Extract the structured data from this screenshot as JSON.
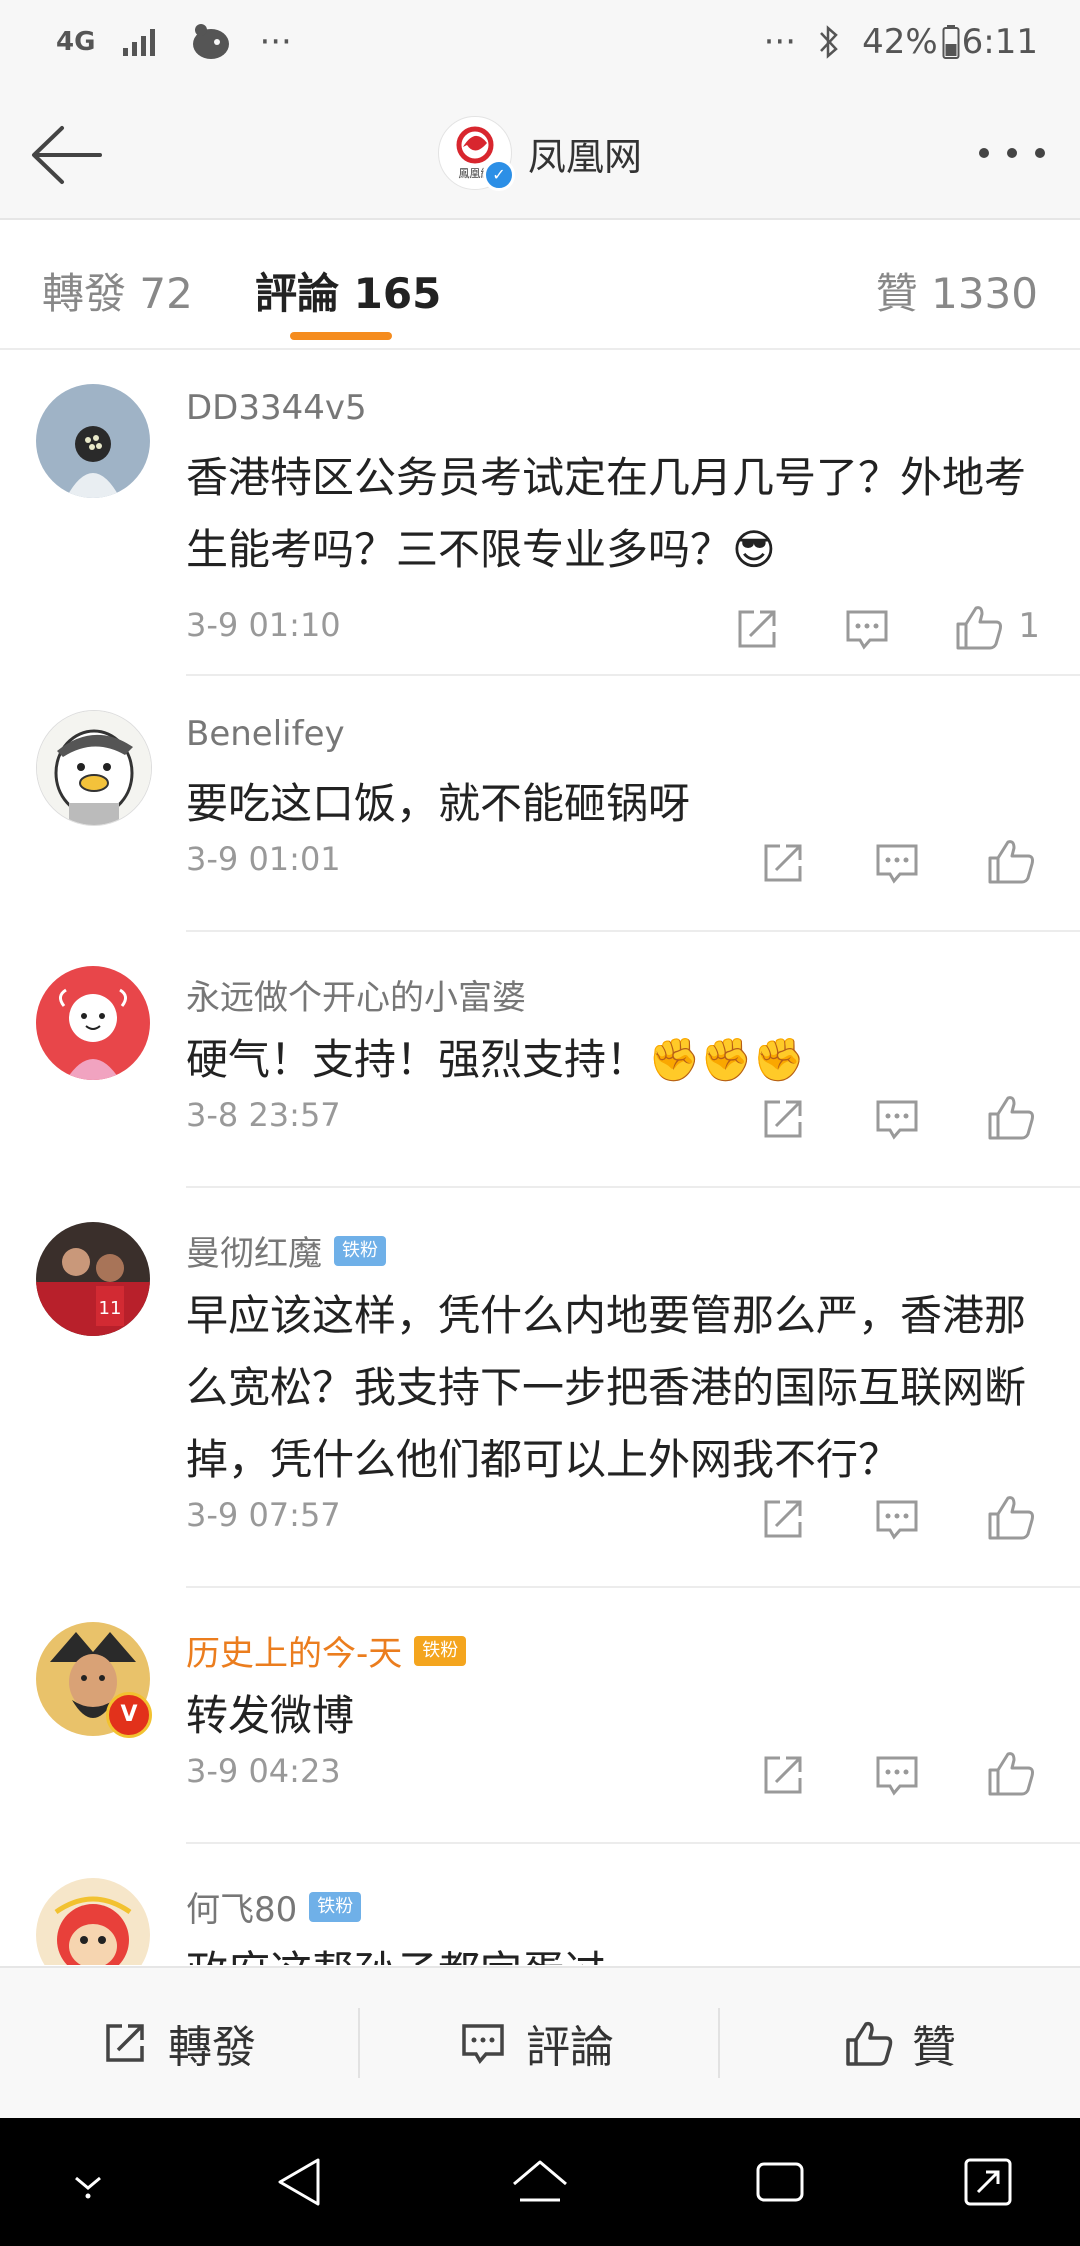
{
  "status_bar": {
    "network": "4G",
    "left_more": "···",
    "right_more": "···",
    "battery": "42%",
    "time": "6:11"
  },
  "header": {
    "account_name": "凤凰网",
    "logo_text": "鳳凰網",
    "back_icon": "arrow-left-icon",
    "more_icon": "more-horizontal-icon"
  },
  "tabs": {
    "reposts": "轉發 72",
    "comments": "評論 165",
    "likes": "贊 1330",
    "active_color": "#f58c1e"
  },
  "comments": [
    {
      "user": "DD3344v5",
      "badge": "",
      "text": "香港特区公务员考试定在几月几号了？外地考生能考吗？三不限专业多吗？😎",
      "time": "3-9 01:10",
      "likes": "1"
    },
    {
      "user": "Benelifey",
      "badge": "",
      "text": "要吃这口饭，就不能砸锅呀",
      "time": "3-9 01:01",
      "likes": ""
    },
    {
      "user": "永远做个开心的小富婆",
      "badge": "",
      "text": "硬气！支持！强烈支持！✊✊✊",
      "time": "3-8 23:57",
      "likes": ""
    },
    {
      "user": "曼彻红魔",
      "badge": "铁粉",
      "text": "早应该这样，凭什么内地要管那么严，香港那么宽松？我支持下一步把香港的国际互联网断掉，凭什么他们都可以上外网我不行？",
      "time": "3-9 07:57",
      "likes": ""
    },
    {
      "user": "历史上的今-天",
      "badge": "铁粉",
      "text": "转发微博",
      "time": "3-9 04:23",
      "likes": ""
    },
    {
      "user": "何飞80",
      "badge": "铁粉",
      "text": "政府这帮孙子都完蛋过",
      "time": "",
      "likes": ""
    }
  ],
  "bottom_bar": {
    "repost": "轉發",
    "comment": "評論",
    "like": "贊"
  }
}
